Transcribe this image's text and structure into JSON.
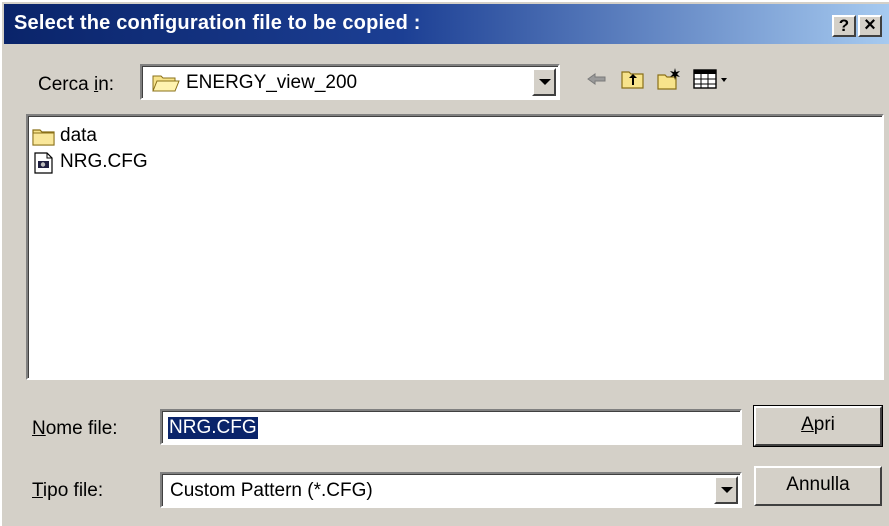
{
  "window": {
    "title": "Select the configuration file to be copied :",
    "help_button": "?",
    "close_button": "×"
  },
  "lookin": {
    "label_prefix": "Cerca ",
    "label_accel": "i",
    "label_suffix": "n:",
    "value": "ENERGY_view_200"
  },
  "toolbar": {
    "back_icon": "back-arrow-icon",
    "up_icon": "up-folder-icon",
    "new_folder_icon": "new-folder-icon",
    "view_menu_icon": "view-menu-icon"
  },
  "files": [
    {
      "name": "data",
      "icon": "folder-icon"
    },
    {
      "name": "NRG.CFG",
      "icon": "cfg-file-icon"
    }
  ],
  "filename": {
    "label_accel": "N",
    "label_rest": "ome file:",
    "value": "NRG.CFG"
  },
  "filetype": {
    "label_accel": "T",
    "label_rest": "ipo file:",
    "value": "Custom Pattern (*.CFG)"
  },
  "buttons": {
    "open_accel": "A",
    "open_rest": "pri",
    "cancel": "Annulla"
  }
}
